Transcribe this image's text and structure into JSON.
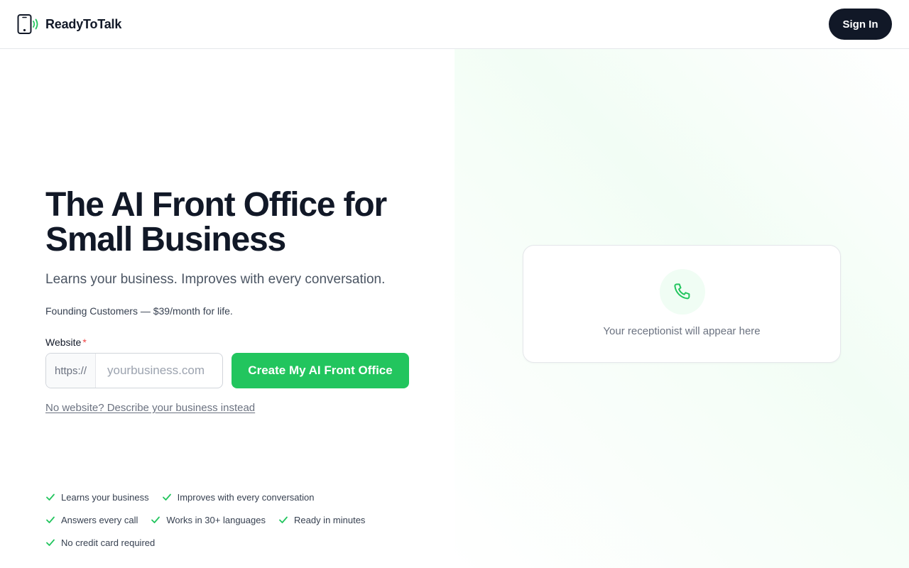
{
  "header": {
    "brand": "ReadyToTalk",
    "sign_in_label": "Sign In"
  },
  "hero": {
    "title_line1": "The AI Front Office for",
    "title_line2": "Small Business",
    "subtitle": "Learns your business. Improves with every conversation.",
    "founding": "Founding Customers — $39/month for life."
  },
  "form": {
    "website_label": "Website",
    "required_marker": "*",
    "prefix": "https://",
    "placeholder": "yourbusiness.com",
    "value": "",
    "submit_label": "Create My AI Front Office",
    "alt_link": "No website? Describe your business instead"
  },
  "features": [
    "Learns your business",
    "Improves with every conversation",
    "Answers every call",
    "Works in 30+ languages",
    "Ready in minutes",
    "No credit card required"
  ],
  "preview": {
    "placeholder_text": "Your receptionist will appear here"
  },
  "colors": {
    "accent": "#22c55e",
    "dark": "#111827",
    "required": "#ef4444"
  },
  "icons": [
    "phone-signal-icon",
    "phone-icon",
    "check-icon"
  ]
}
